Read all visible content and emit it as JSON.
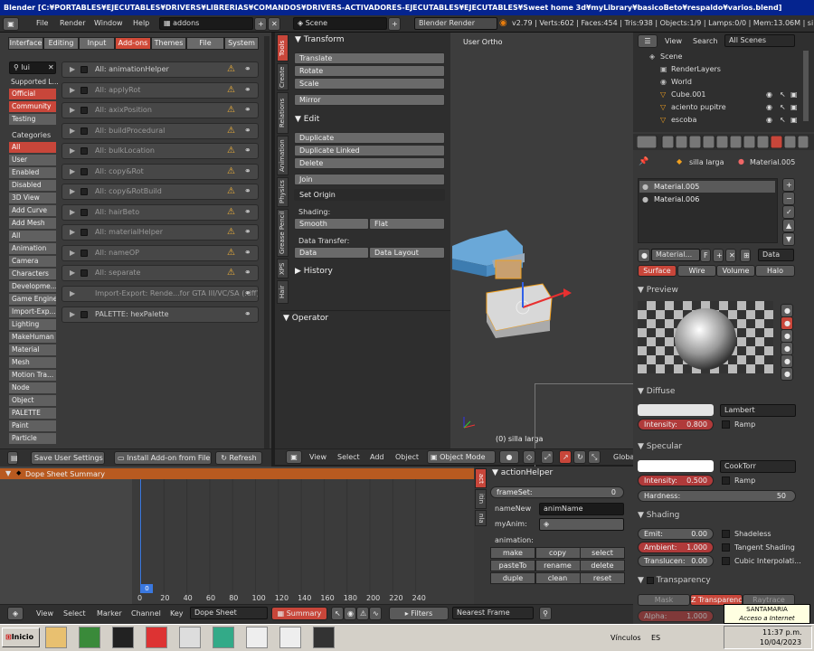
{
  "window": {
    "title": "Blender [C:¥PORTABLES¥EJECUTABLES¥DRIVERS¥LIBRERIAS¥COMANDOS¥DRIVERS-ACTIVADORES-EJECUTABLES¥EJECUTABLES¥Sweet home 3d¥myLibrary¥basicoBeto¥respaldo¥varios.blend]"
  },
  "infobar": {
    "menus": [
      "File",
      "Render",
      "Window",
      "Help"
    ],
    "screen_name": "addons",
    "scene_name": "Scene",
    "render_engine": "Blender Render",
    "stats": "v2.79 | Verts:602 | Faces:454 | Tris:938 | Objects:1/9 | Lamps:0/0 | Mem:13.06M | silla larga"
  },
  "prefs": {
    "tabs": [
      "Interface",
      "Editing",
      "Input",
      "Add-ons",
      "Themes",
      "File",
      "System"
    ],
    "search_value": "lui",
    "supported_label": "Supported L...",
    "support_levels": [
      "Official",
      "Community",
      "Testing"
    ],
    "categories_label": "Categories",
    "categories": [
      "All",
      "User",
      "Enabled",
      "Disabled",
      "3D View",
      "Add Curve",
      "Add Mesh",
      "All",
      "Animation",
      "Camera",
      "Characters",
      "Developme...",
      "Game Engine",
      "Import-Exp...",
      "Lighting",
      "MakeHuman",
      "Material",
      "Mesh",
      "Motion Tra...",
      "Node",
      "Object",
      "PALETTE",
      "Paint",
      "Particle"
    ],
    "addons": [
      "All: animationHelper",
      "All: applyRot",
      "All: axixPosition",
      "All: buildProcedural",
      "All: bulkLocation",
      "All: copy&Rot",
      "All: copy&RotBuild",
      "All: hairBeto",
      "All: materialHelper",
      "All: nameOP",
      "All: separate",
      "Import-Export: Rende...for GTA III/VC/SA (.dff)",
      "PALETTE: hexPalette"
    ],
    "save_button": "Save User Settings",
    "install_button": "Install Add-on from File...",
    "refresh_button": "Refresh"
  },
  "toolshelf": {
    "tabs": [
      "Tools",
      "Create",
      "Relations",
      "Animation",
      "Physics",
      "Grease Pencil",
      "XPS",
      "Hair"
    ],
    "transform_title": "Transform",
    "translate": "Translate",
    "rotate": "Rotate",
    "scale": "Scale",
    "mirror": "Mirror",
    "edit_title": "Edit",
    "duplicate": "Duplicate",
    "duplicate_linked": "Duplicate Linked",
    "delete": "Delete",
    "join": "Join",
    "set_origin": "Set Origin",
    "shading_label": "Shading:",
    "smooth": "Smooth",
    "flat": "Flat",
    "data_transfer_label": "Data Transfer:",
    "data": "Data",
    "data_layout": "Data Layout",
    "history_title": "History",
    "operator_title": "Operator"
  },
  "viewport": {
    "label": "User Ortho",
    "object_label": "(0) silla larga",
    "menus": [
      "View",
      "Select",
      "Add",
      "Object"
    ],
    "mode": "Object Mode",
    "global_label": "Global"
  },
  "outliner": {
    "menus": [
      "View",
      "Search"
    ],
    "scenes_select": "All Scenes",
    "items": [
      "Scene",
      "RenderLayers",
      "World",
      "Cube.001",
      "aciento pupitre",
      "escoba"
    ]
  },
  "properties": {
    "breadcrumb_object": "silla larga",
    "breadcrumb_material": "Material.005",
    "slots": [
      "Material.005",
      "Material.006"
    ],
    "material_name": "Material...",
    "material_f": "F",
    "data_select": "Data",
    "type_tabs": [
      "Surface",
      "Wire",
      "Volume",
      "Halo"
    ],
    "preview_title": "Preview",
    "diffuse_title": "Diffuse",
    "diffuse_shader": "Lambert",
    "diffuse_intensity_label": "Intensity:",
    "diffuse_intensity": "0.800",
    "ramp": "Ramp",
    "specular_title": "Specular",
    "specular_shader": "CookTorr",
    "specular_intensity_label": "Intensity:",
    "specular_intensity": "0.500",
    "hardness_label": "Hardness:",
    "hardness": "50",
    "shading_title": "Shading",
    "emit_label": "Emit:",
    "emit": "0.00",
    "shadeless": "Shadeless",
    "ambient_label": "Ambient:",
    "ambient": "1.000",
    "tangent_shading": "Tangent Shading",
    "translucency_label": "Translucen:",
    "translucency": "0.00",
    "cubic": "Cubic Interpolati...",
    "transparency_title": "Transparency",
    "mask": "Mask",
    "z_transparency": "Z Transparency",
    "raytrace": "Raytrace",
    "alpha_label": "Alpha:",
    "alpha": "1.000",
    "colors": {
      "diffuse": "#e4e4e4",
      "specular": "#ffffff"
    }
  },
  "dopesheet": {
    "summary": "Dope Sheet Summary",
    "current_frame": "0",
    "ticks": [
      "0",
      "20",
      "40",
      "60",
      "80",
      "100",
      "120",
      "140",
      "160",
      "180",
      "200",
      "220",
      "240"
    ],
    "menus": [
      "View",
      "Select",
      "Marker",
      "Channel",
      "Key"
    ],
    "mode": "Dope Sheet",
    "summary_button": "Summary",
    "filters": "Filters",
    "interpolation": "Nearest Frame"
  },
  "action_helper": {
    "tabs": [
      "act",
      "itin",
      "nla"
    ],
    "title": "actionHelper",
    "frameset_label": "frameSet:",
    "frameset": "0",
    "namenew_label": "nameNew",
    "namenew_value": "animName",
    "myanim_label": "myAnim:",
    "animation_label": "animation:",
    "buttons": [
      "make",
      "copy",
      "select",
      "pasteTo",
      "rename",
      "delete",
      "duple",
      "clean",
      "reset"
    ]
  },
  "taskbar": {
    "start": "Inicio",
    "links": "Vínculos",
    "lang": "ES",
    "time": "11:37 p.m.",
    "date": "10/04/2023",
    "tooltip_name": "SANTAMARIA",
    "tooltip_status": "Acceso a Internet"
  }
}
